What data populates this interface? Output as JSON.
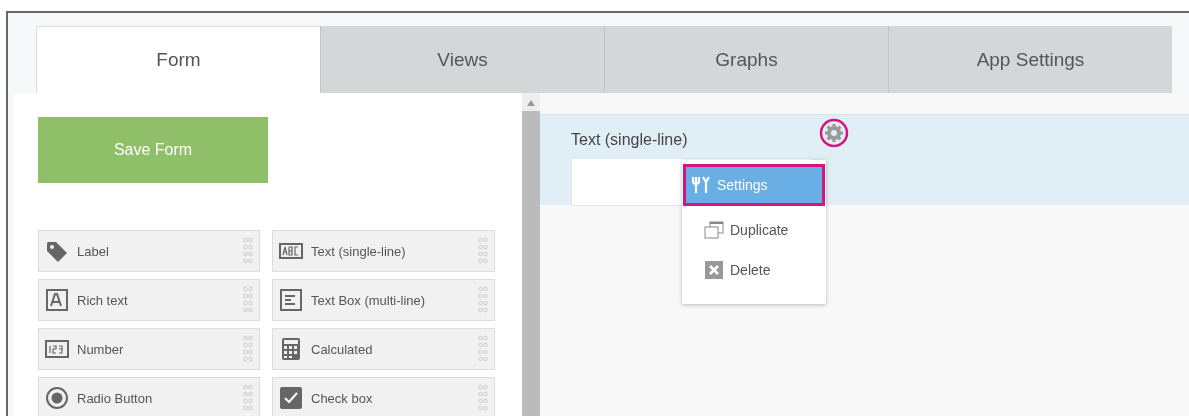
{
  "tabs": [
    {
      "label": "Form",
      "selected": true
    },
    {
      "label": "Views",
      "selected": false
    },
    {
      "label": "Graphs",
      "selected": false
    },
    {
      "label": "App Settings",
      "selected": false
    }
  ],
  "save_button": "Save Form",
  "palette": [
    {
      "label": "Label",
      "kind": "tag"
    },
    {
      "label": "Text (single-line)",
      "kind": "abc"
    },
    {
      "label": "Rich text",
      "kind": "rich"
    },
    {
      "label": "Text Box (multi-line)",
      "kind": "multiline"
    },
    {
      "label": "Number",
      "kind": "number"
    },
    {
      "label": "Calculated",
      "kind": "calc"
    },
    {
      "label": "Radio Button",
      "kind": "radio"
    },
    {
      "label": "Check box",
      "kind": "check"
    }
  ],
  "field": {
    "label": "Text (single-line)"
  },
  "menu": [
    {
      "label": "Settings",
      "kind": "settings",
      "selected": true
    },
    {
      "label": "Duplicate",
      "kind": "duplicate",
      "selected": false
    },
    {
      "label": "Delete",
      "kind": "delete",
      "selected": false
    }
  ]
}
